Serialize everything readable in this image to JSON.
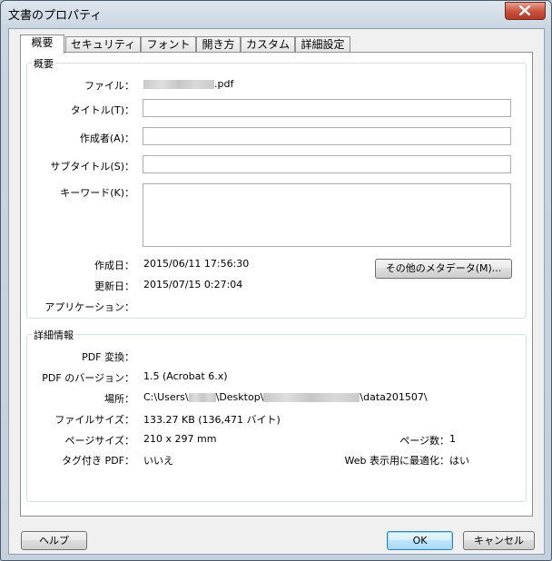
{
  "window": {
    "title": "文書のプロパティ"
  },
  "tabs": [
    {
      "label": "概要"
    },
    {
      "label": "セキュリティ"
    },
    {
      "label": "フォント"
    },
    {
      "label": "開き方"
    },
    {
      "label": "カスタム"
    },
    {
      "label": "詳細設定"
    }
  ],
  "summary": {
    "group_label": "概要",
    "file_label": "ファイル：",
    "file_value_suffix": ".pdf",
    "title_label": "タイトル(T)：",
    "title_value": "",
    "author_label": "作成者(A)：",
    "author_value": "",
    "subject_label": "サブタイトル(S)：",
    "subject_value": "",
    "keywords_label": "キーワード(K)：",
    "keywords_value": "",
    "created_label": "作成日：",
    "created_value": "2015/06/11 17:56:30",
    "modified_label": "更新日：",
    "modified_value": "2015/07/15 0:27:04",
    "application_label": "アプリケーション：",
    "metadata_button": "その他のメタデータ(M)..."
  },
  "advanced": {
    "group_label": "詳細情報",
    "producer_label": "PDF 変換：",
    "version_label": "PDF のバージョン：",
    "version_value": "1.5 (Acrobat 6.x)",
    "location_label": "場所：",
    "location_prefix": "C:\\Users\\",
    "location_mid": "\\Desktop\\",
    "location_suffix": "\\data201507\\",
    "filesize_label": "ファイルサイズ：",
    "filesize_value": "133.27 KB (136,471 バイト)",
    "pagesize_label": "ページサイズ：",
    "pagesize_value": "210 x 297 mm",
    "pagecount_label": "ページ数：",
    "pagecount_value": "1",
    "tagged_label": "タグ付き PDF：",
    "tagged_value": "いいえ",
    "fastweb_label": "Web 表示用に最適化：",
    "fastweb_value": "はい"
  },
  "footer": {
    "help_button": "ヘルプ",
    "ok_button": "OK",
    "cancel_button": "キャンセル"
  }
}
